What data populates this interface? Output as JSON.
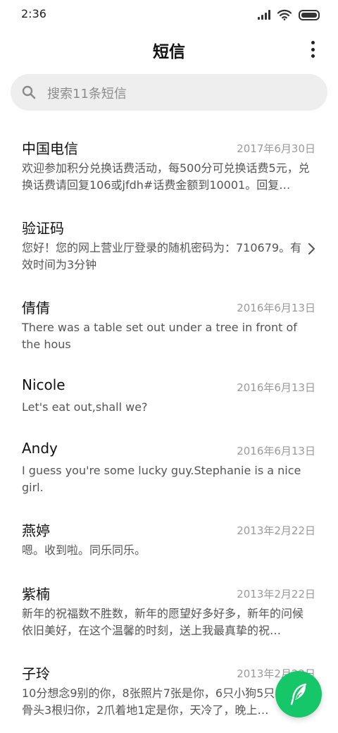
{
  "status_bar": {
    "time": "2:36",
    "icons": [
      "signal-icon",
      "wifi-icon",
      "battery-icon"
    ]
  },
  "header": {
    "title": "短信",
    "more_icon": "more-vertical-icon"
  },
  "search": {
    "placeholder": "搜索11条短信",
    "icon": "search-icon"
  },
  "messages": [
    {
      "name": "中国电信",
      "date": "2017年6月30日",
      "preview": "欢迎参加积分兑换话费活动，每500分可兑换话费5元，兑换话费请回复106或jfdh#话费金额到10001。回复…"
    },
    {
      "name": "验证码",
      "date": "",
      "preview": "您好！您的网上营业厅登录的随机密码为：710679。有效时间为3分钟"
    },
    {
      "name": "倩倩",
      "date": "2016年6月13日",
      "preview": "There was a table set out under a tree in front of the hous"
    },
    {
      "name": "Nicole",
      "date": "2016年6月13日",
      "preview": "Let's eat out,shall we?"
    },
    {
      "name": "Andy",
      "date": "2016年6月13日",
      "preview": "I guess you're some lucky guy.Stephanie is a nice girl."
    },
    {
      "name": "燕婷",
      "date": "2013年2月22日",
      "preview": "嗯。收到啦。同乐同乐。"
    },
    {
      "name": "紫楠",
      "date": "2013年2月22日",
      "preview": "新年的祝福数不胜数，新年的愿望好多好多，新年的问候依旧美好，在这个温馨的时刻，送上我最真挚的祝…"
    },
    {
      "name": "子玲",
      "date": "2013年2月22日",
      "preview": "10分想念9别的你，8张照片7张是你，6只小狗5只…4根骨头3根归你，2爪着地1定是你，天冷了，晚上…"
    }
  ],
  "fab": {
    "icon": "feather-compose-icon",
    "color": "#16c76a"
  }
}
